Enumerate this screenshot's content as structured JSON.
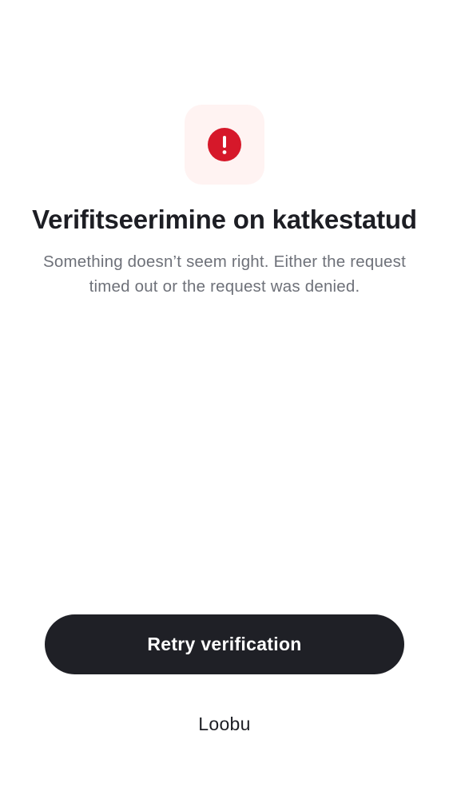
{
  "status": {
    "icon": "alert-circle-icon",
    "icon_color": "#d6182a",
    "icon_background": "#fff3f2"
  },
  "title": "Verifitseerimine on katkestatud",
  "subtitle": "Something doesn’t seem right. Either the request timed out or the request was denied.",
  "actions": {
    "retry_label": "Retry verification",
    "cancel_label": "Loobu"
  },
  "colors": {
    "primary_button": "#1f2026",
    "text_primary": "#1d1e24",
    "text_secondary": "#6e7179"
  }
}
